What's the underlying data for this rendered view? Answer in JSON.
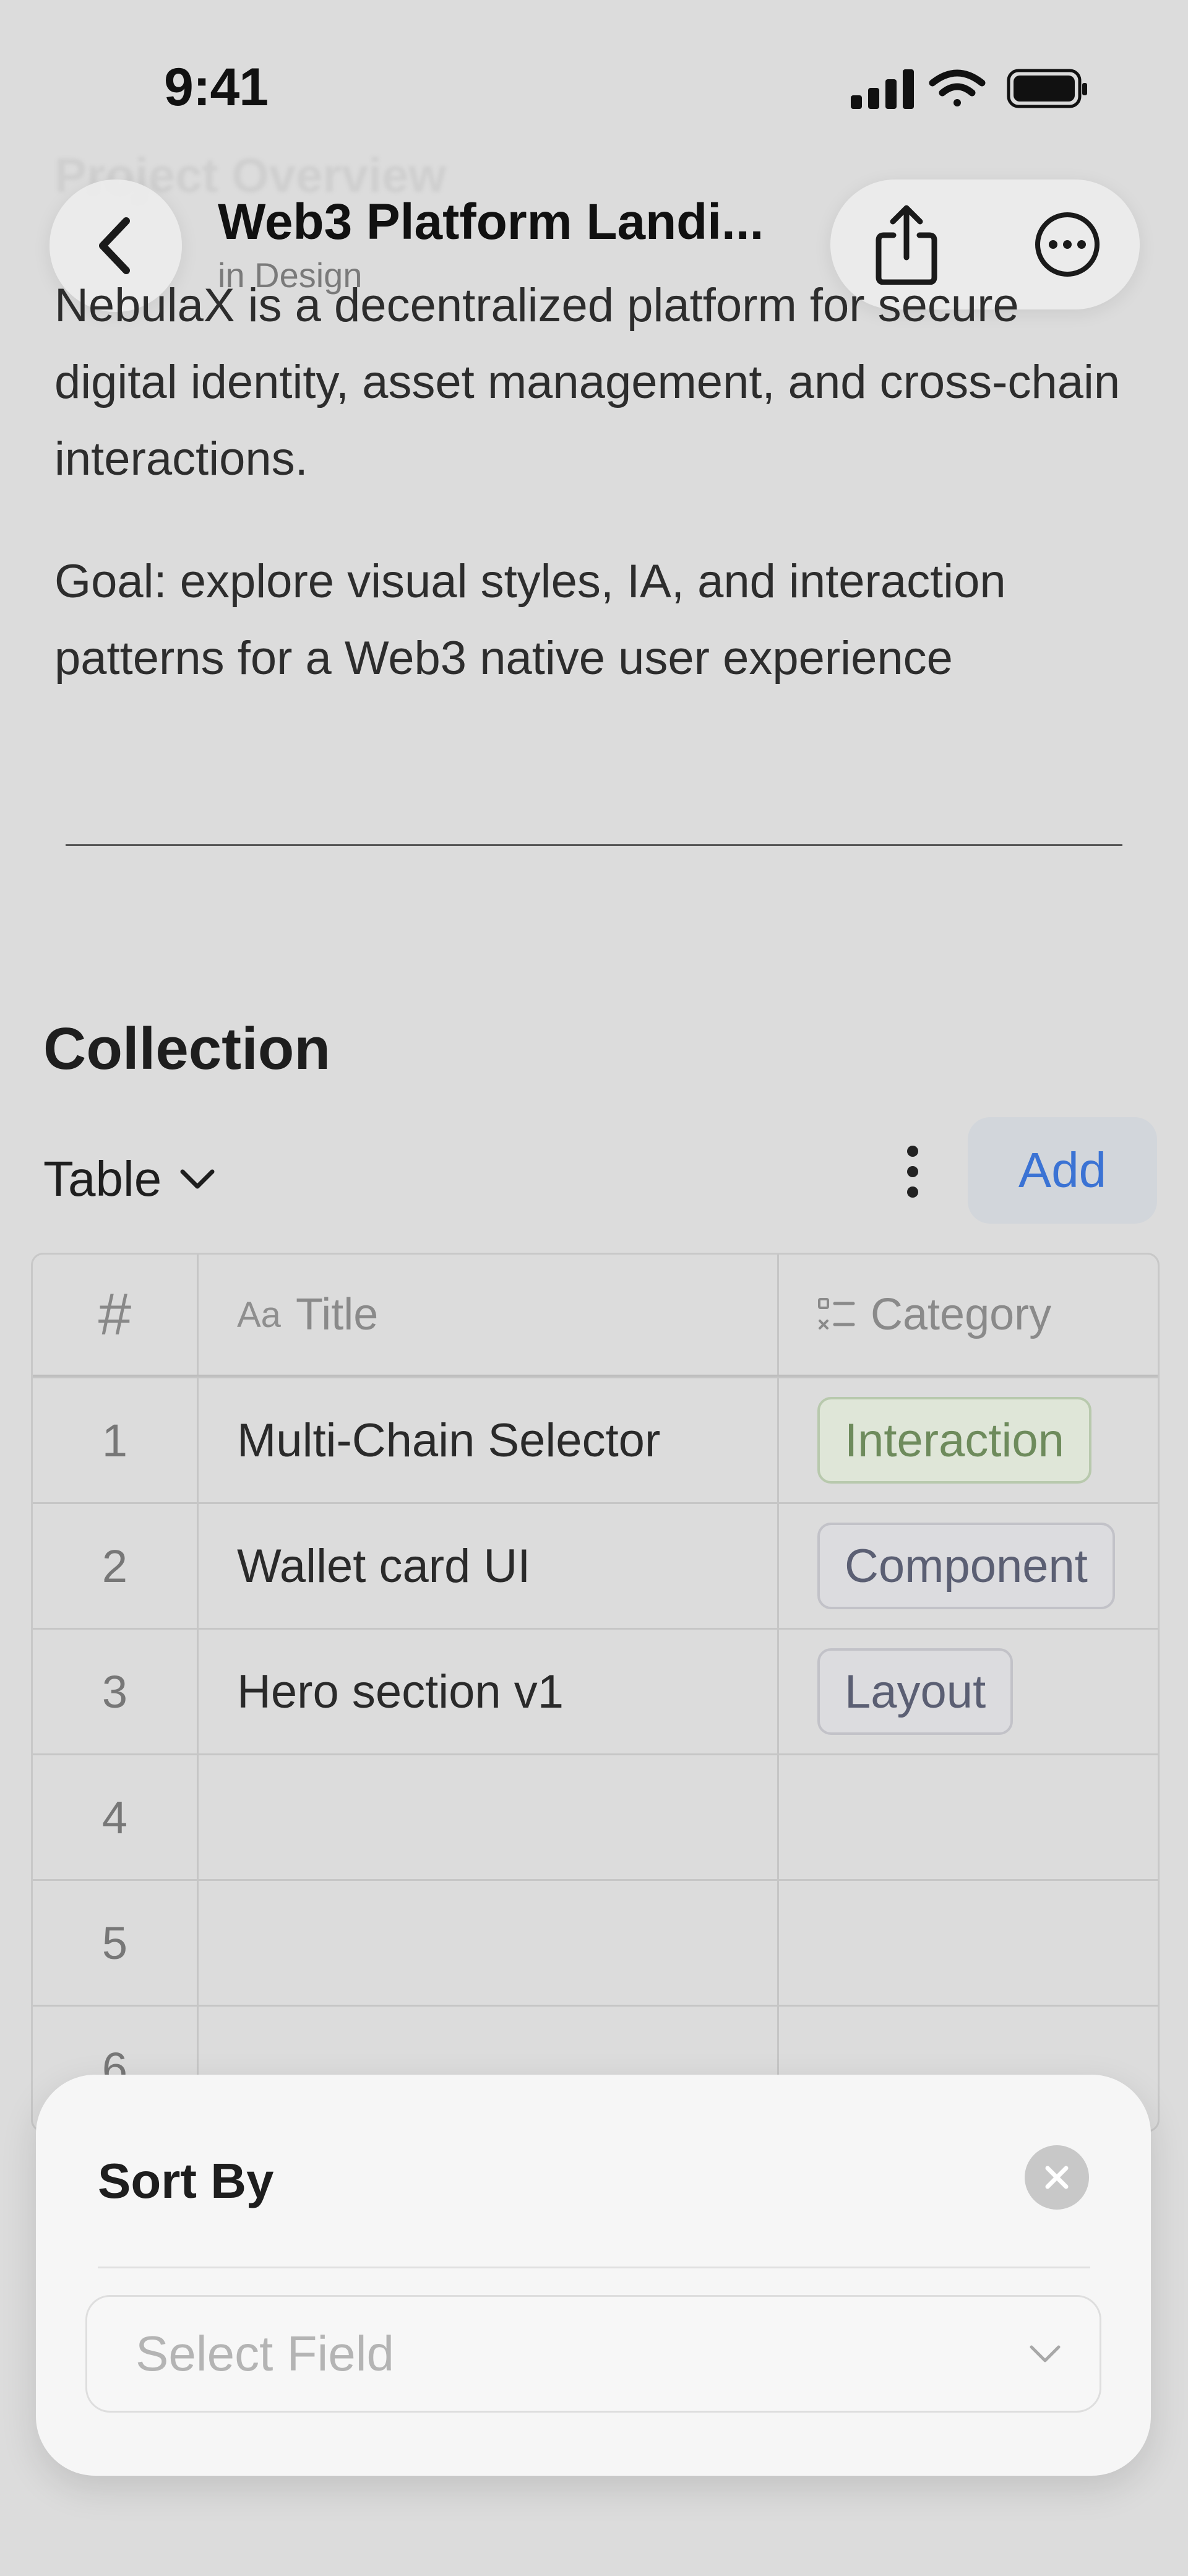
{
  "status_bar": {
    "time": "9:41"
  },
  "background_heading": "Project Overview",
  "nav": {
    "title": "Web3 Platform Landi...",
    "subtitle": "in Design",
    "back_icon": "chevron-left-icon",
    "share_icon": "share-icon",
    "more_icon": "ellipsis-circle-icon"
  },
  "description": {
    "paragraph1": "NebulaX is a decentralized platform for secure digital identity, asset management, and cross-chain interactions.",
    "paragraph2": "Goal: explore visual styles, IA, and interaction patterns for a Web3 native user experience"
  },
  "collection": {
    "title": "Collection",
    "view": "Table",
    "add_label": "Add",
    "columns": {
      "number": "#",
      "title_prefix": "Aa",
      "title": "Title",
      "category": "Category"
    },
    "rows": [
      {
        "num": "1",
        "title": "Multi-Chain Selector",
        "category": "Interaction"
      },
      {
        "num": "2",
        "title": "Wallet card UI",
        "category": "Component"
      },
      {
        "num": "3",
        "title": "Hero section v1",
        "category": "Layout"
      },
      {
        "num": "4",
        "title": "",
        "category": ""
      },
      {
        "num": "5",
        "title": "",
        "category": ""
      },
      {
        "num": "6",
        "title": "",
        "category": ""
      }
    ]
  },
  "sort_sheet": {
    "title": "Sort By",
    "field_placeholder": "Select Field"
  },
  "colors": {
    "accent": "#3b73d4",
    "interaction_tag": "#6e8b5c",
    "neutral_tag": "#5b5f73"
  }
}
